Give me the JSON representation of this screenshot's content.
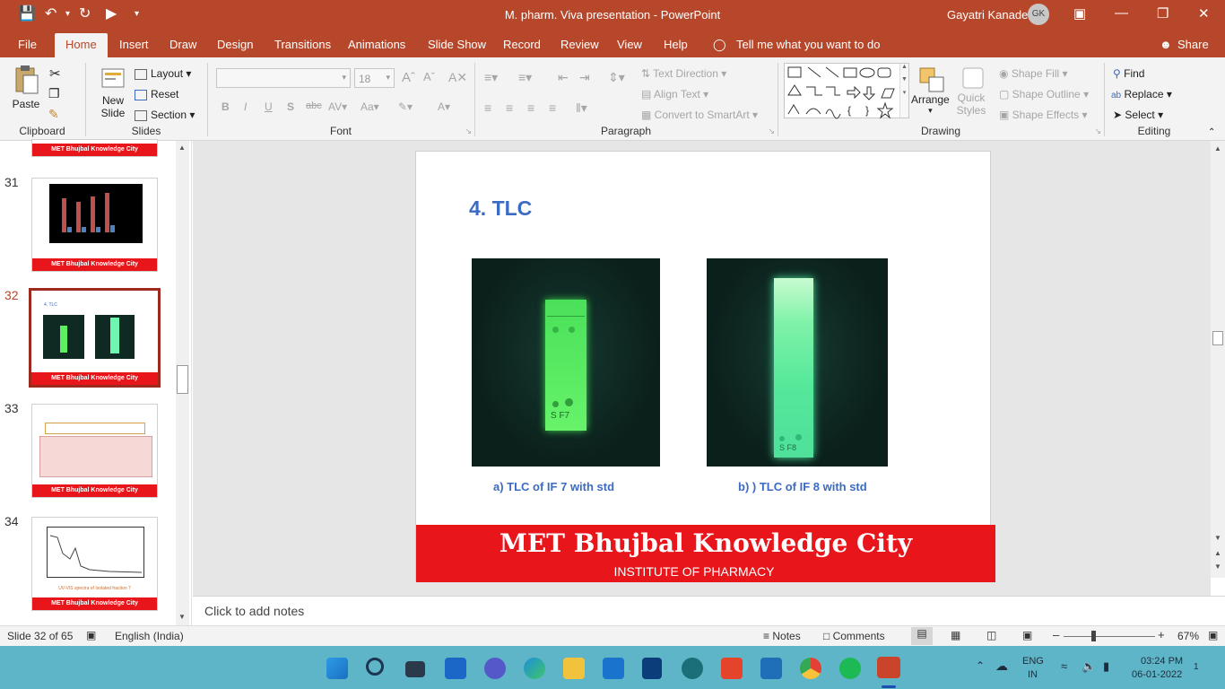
{
  "titlebar": {
    "title": "M. pharm. Viva presentation  -  PowerPoint",
    "user": "Gayatri Kanade",
    "initials": "GK"
  },
  "tabs": {
    "file": "File",
    "home": "Home",
    "insert": "Insert",
    "draw": "Draw",
    "design": "Design",
    "transitions": "Transitions",
    "animations": "Animations",
    "slideshow": "Slide Show",
    "record": "Record",
    "review": "Review",
    "view": "View",
    "help": "Help",
    "tellme": "Tell me what you want to do",
    "share": "Share"
  },
  "ribbon": {
    "clipboard": {
      "label": "Clipboard",
      "paste": "Paste"
    },
    "slides": {
      "label": "Slides",
      "new_slide_1": "New",
      "new_slide_2": "Slide",
      "layout": "Layout",
      "reset": "Reset",
      "section": "Section"
    },
    "font": {
      "label": "Font",
      "size": "18"
    },
    "paragraph": {
      "label": "Paragraph",
      "text_direction": "Text Direction",
      "align_text": "Align Text",
      "smartart": "Convert to SmartArt"
    },
    "drawing": {
      "label": "Drawing",
      "arrange": "Arrange",
      "quick_styles_1": "Quick",
      "quick_styles_2": "Styles",
      "shape_fill": "Shape Fill",
      "shape_outline": "Shape Outline",
      "shape_effects": "Shape Effects"
    },
    "editing": {
      "label": "Editing",
      "find": "Find",
      "replace": "Replace",
      "select": "Select"
    }
  },
  "thumbnails": {
    "n31": "31",
    "n32": "32",
    "n33": "33",
    "n34": "34",
    "banner": "MET Bhujbal Knowledge City",
    "t34_caption": "UV-VIS spectra of Isolated fraction 7"
  },
  "slide": {
    "title": "4. TLC",
    "caption_a": "a) TLC of IF 7 with std",
    "caption_b": "b) ) TLC of IF 8 with std",
    "plate_a_label": "S  F7",
    "plate_b_label": "S  F8",
    "banner_main": "MET Bhujbal Knowledge City",
    "banner_sub": "INSTITUTE OF PHARMACY"
  },
  "notes": {
    "placeholder": "Click to add notes"
  },
  "statusbar": {
    "slide_info": "Slide 32 of 65",
    "language": "English (India)",
    "notes": "Notes",
    "comments": "Comments",
    "zoom": "67%"
  },
  "taskbar": {
    "lang1": "ENG",
    "lang2": "IN",
    "time": "03:24 PM",
    "date": "06-01-2022",
    "notif": "1"
  },
  "colors": {
    "accent": "#b7472a",
    "banner_red": "#e8151b",
    "title_blue": "#3b6bc2",
    "taskbar": "#5fb5c8"
  }
}
